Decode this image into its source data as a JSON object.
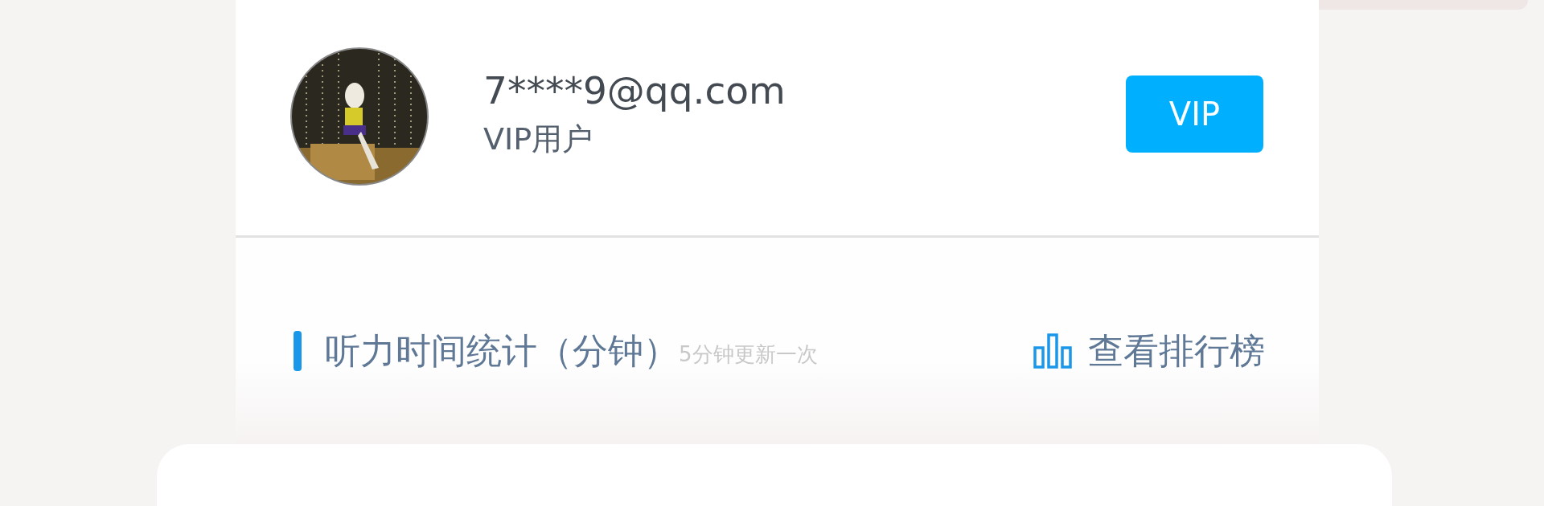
{
  "profile": {
    "account": "7****9@qq.com",
    "membership": "VIP用户",
    "badge": "VIP"
  },
  "listening_stats": {
    "title": "听力时间统计（分钟）",
    "note": "5分钟更新一次",
    "ranking_link": "查看排行榜"
  }
}
